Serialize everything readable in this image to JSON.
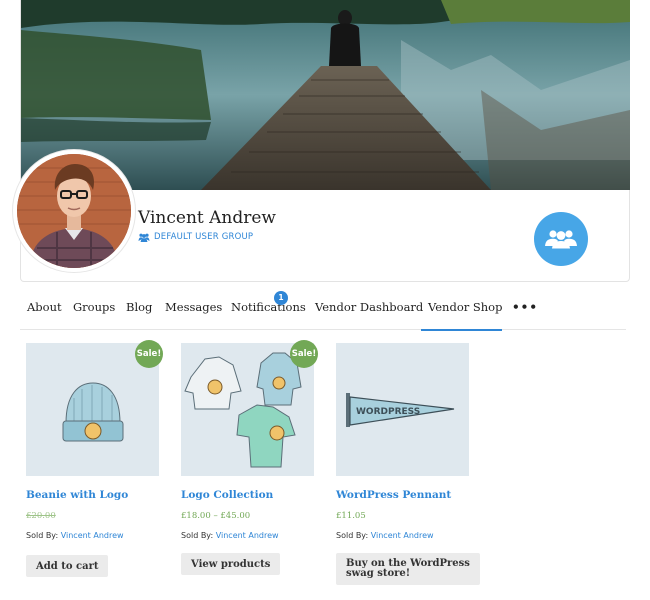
{
  "profile": {
    "name": "Vincent Andrew",
    "group_label": "DEFAULT USER GROUP"
  },
  "tabs": [
    {
      "label": "About",
      "active": false
    },
    {
      "label": "Groups",
      "active": false
    },
    {
      "label": "Blog",
      "active": false
    },
    {
      "label": "Messages",
      "active": false
    },
    {
      "label": "Notifications",
      "active": false,
      "badge": "1"
    },
    {
      "label": "Vendor Dashboard",
      "active": false
    },
    {
      "label": "Vendor Shop",
      "active": true
    },
    {
      "label": "•••",
      "active": false
    }
  ],
  "products": [
    {
      "title": "Beanie with Logo",
      "price_old": "£20.00",
      "price": "",
      "sold_by_label": "Sold By:",
      "vendor": "Vincent Andrew",
      "button": "Add to cart",
      "sale": "Sale!"
    },
    {
      "title": "Logo Collection",
      "price": "£18.00 – £45.00",
      "sold_by_label": "Sold By:",
      "vendor": "Vincent Andrew",
      "button": "View products",
      "sale": "Sale!"
    },
    {
      "title": "WordPress Pennant",
      "price": "£11.05",
      "sold_by_label": "Sold By:",
      "vendor": "Vincent Andrew",
      "button_line1": "Buy on the WordPress",
      "button_line2": "swag store!",
      "pennant_text": "WORDPRESS"
    }
  ],
  "colors": {
    "accent": "#2f86d6",
    "sale_green": "#72a856",
    "group_circle": "#47a6e7"
  }
}
